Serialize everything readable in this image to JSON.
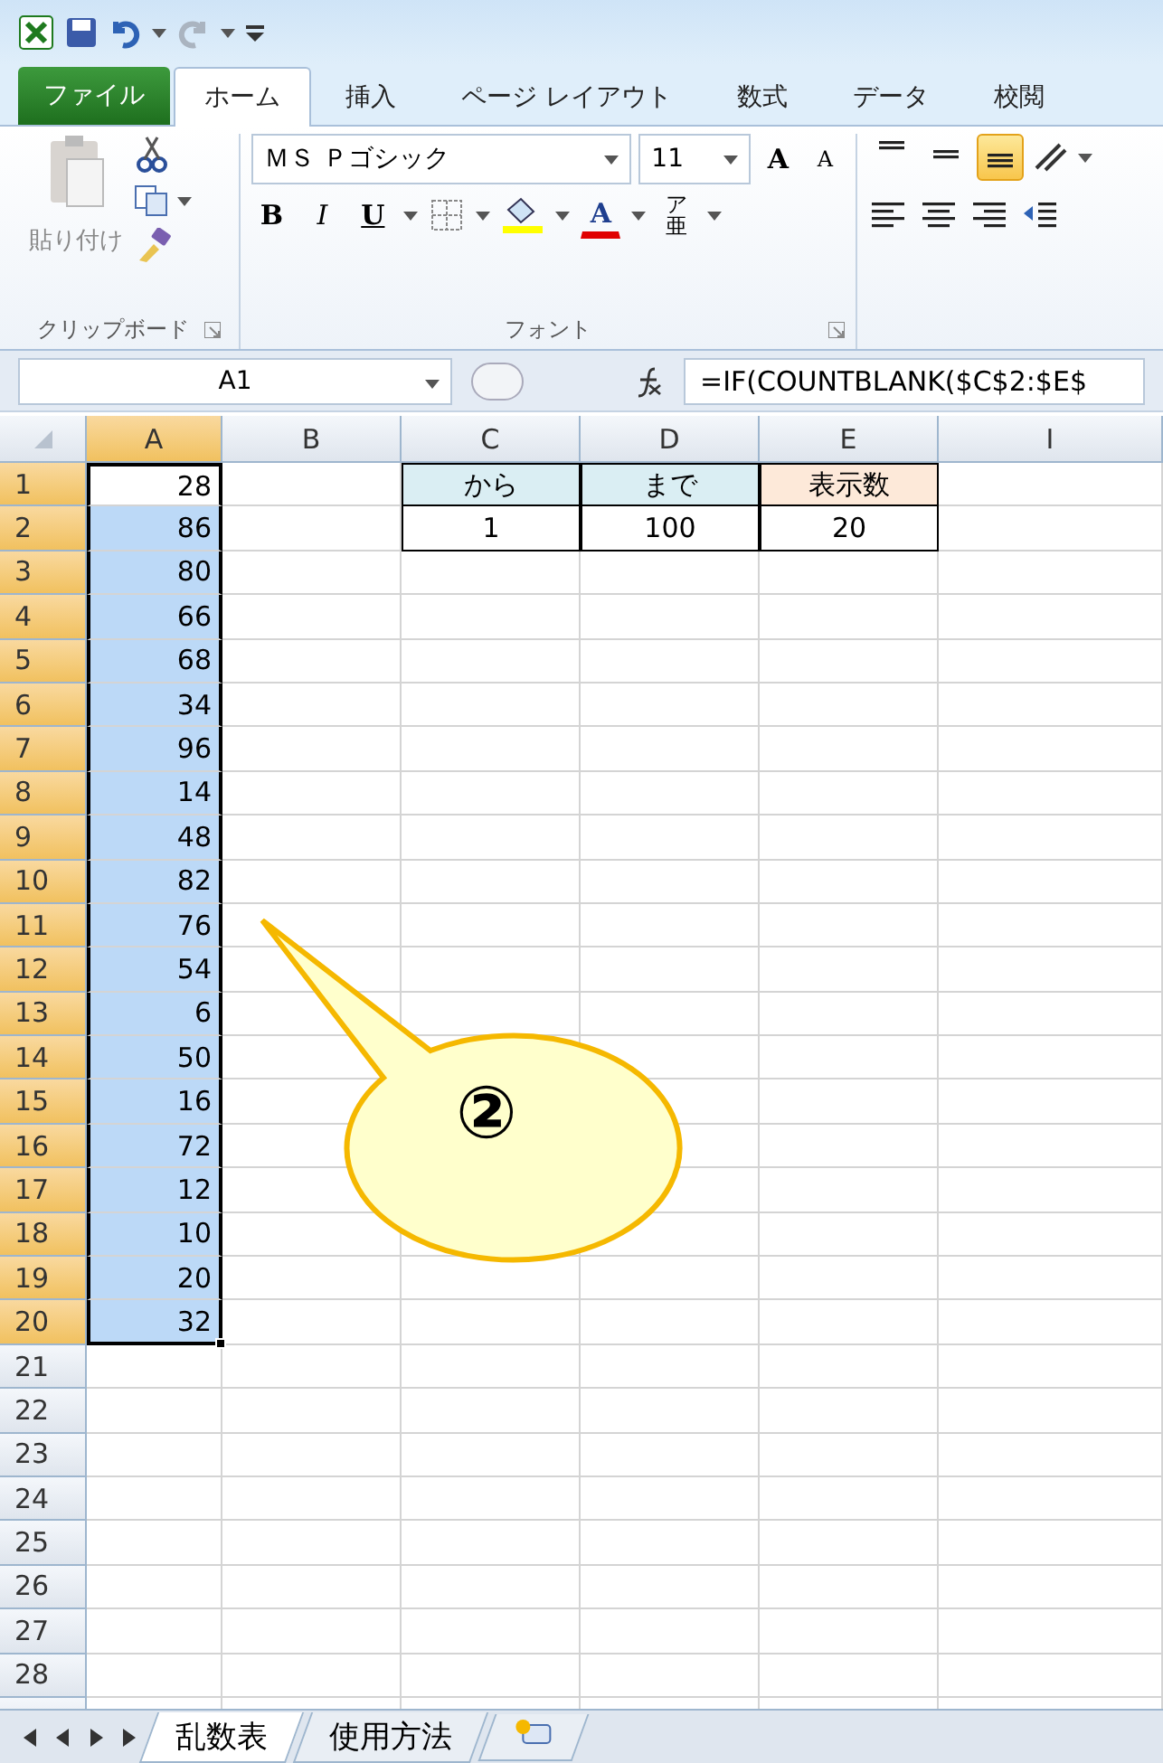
{
  "quick_access": {
    "redo_disabled": true
  },
  "ribbon_tabs": [
    {
      "label": "ファイル",
      "kind": "file",
      "selected": false
    },
    {
      "label": "ホーム",
      "kind": "tab",
      "selected": true
    },
    {
      "label": "挿入",
      "kind": "tab",
      "selected": false
    },
    {
      "label": "ページ レイアウト",
      "kind": "tab",
      "selected": false
    },
    {
      "label": "数式",
      "kind": "tab",
      "selected": false
    },
    {
      "label": "データ",
      "kind": "tab",
      "selected": false
    },
    {
      "label": "校閲",
      "kind": "tab",
      "selected": false
    }
  ],
  "clipboard": {
    "paste_label": "貼り付け",
    "group_label": "クリップボード"
  },
  "font": {
    "font_name": "ＭＳ Ｐゴシック",
    "font_size": "11",
    "grow": "A",
    "shrink": "A",
    "bold": "B",
    "italic": "I",
    "underline": "U",
    "font_color_letter": "A",
    "phonetic_ruby": "ア",
    "phonetic_base": "亜",
    "group_label": "フォント"
  },
  "alignment": {
    "vertical": [
      {
        "kind": "top",
        "selected": false
      },
      {
        "kind": "middle",
        "selected": false
      },
      {
        "kind": "bottom",
        "selected": true
      }
    ]
  },
  "formula_bar": {
    "name_box": "A1",
    "formula": "=IF(COUNTBLANK($C$2:$E$"
  },
  "columns": [
    {
      "label": "A",
      "selected": true
    },
    {
      "label": "B",
      "selected": false
    },
    {
      "label": "C",
      "selected": false
    },
    {
      "label": "D",
      "selected": false
    },
    {
      "label": "E",
      "selected": false
    },
    {
      "label": "I",
      "selected": false
    }
  ],
  "rows": [
    {
      "number": "1",
      "selected": true,
      "cells": [
        {
          "value": "28",
          "selected": true,
          "active": true
        },
        {},
        {
          "value": "から",
          "color": "#daeef3",
          "centered": true,
          "bordered": true
        },
        {
          "value": "まで",
          "color": "#daeef3",
          "centered": true,
          "bordered": true
        },
        {
          "value": "表示数",
          "color": "#fde9d9",
          "centered": true,
          "bordered": true
        },
        {}
      ]
    },
    {
      "number": "2",
      "selected": true,
      "cells": [
        {
          "value": "86",
          "selected": true
        },
        {},
        {
          "value": "1",
          "centered": true,
          "bordered": true
        },
        {
          "value": "100",
          "centered": true,
          "bordered": true
        },
        {
          "value": "20",
          "centered": true,
          "bordered": true
        },
        {}
      ]
    },
    {
      "number": "3",
      "selected": true,
      "cells": [
        {
          "value": "80",
          "selected": true
        }
      ]
    },
    {
      "number": "4",
      "selected": true,
      "cells": [
        {
          "value": "66",
          "selected": true
        }
      ]
    },
    {
      "number": "5",
      "selected": true,
      "cells": [
        {
          "value": "68",
          "selected": true
        }
      ]
    },
    {
      "number": "6",
      "selected": true,
      "cells": [
        {
          "value": "34",
          "selected": true
        }
      ]
    },
    {
      "number": "7",
      "selected": true,
      "cells": [
        {
          "value": "96",
          "selected": true
        }
      ]
    },
    {
      "number": "8",
      "selected": true,
      "cells": [
        {
          "value": "14",
          "selected": true
        }
      ]
    },
    {
      "number": "9",
      "selected": true,
      "cells": [
        {
          "value": "48",
          "selected": true
        }
      ]
    },
    {
      "number": "10",
      "selected": true,
      "cells": [
        {
          "value": "82",
          "selected": true
        }
      ]
    },
    {
      "number": "11",
      "selected": true,
      "cells": [
        {
          "value": "76",
          "selected": true
        }
      ]
    },
    {
      "number": "12",
      "selected": true,
      "cells": [
        {
          "value": "54",
          "selected": true
        }
      ]
    },
    {
      "number": "13",
      "selected": true,
      "cells": [
        {
          "value": "6",
          "selected": true
        }
      ]
    },
    {
      "number": "14",
      "selected": true,
      "cells": [
        {
          "value": "50",
          "selected": true
        }
      ]
    },
    {
      "number": "15",
      "selected": true,
      "cells": [
        {
          "value": "16",
          "selected": true
        }
      ]
    },
    {
      "number": "16",
      "selected": true,
      "cells": [
        {
          "value": "72",
          "selected": true
        }
      ]
    },
    {
      "number": "17",
      "selected": true,
      "cells": [
        {
          "value": "12",
          "selected": true
        }
      ]
    },
    {
      "number": "18",
      "selected": true,
      "cells": [
        {
          "value": "10",
          "selected": true
        }
      ]
    },
    {
      "number": "19",
      "selected": true,
      "cells": [
        {
          "value": "20",
          "selected": true
        }
      ]
    },
    {
      "number": "20",
      "selected": true,
      "cells": [
        {
          "value": "32",
          "selected": true
        }
      ]
    },
    {
      "number": "21",
      "selected": false
    },
    {
      "number": "22",
      "selected": false
    },
    {
      "number": "23",
      "selected": false
    },
    {
      "number": "24",
      "selected": false
    },
    {
      "number": "25",
      "selected": false
    },
    {
      "number": "26",
      "selected": false
    },
    {
      "number": "27",
      "selected": false
    },
    {
      "number": "28",
      "selected": false
    }
  ],
  "callout": {
    "text": "②"
  },
  "sheet_tabs": [
    {
      "label": "乱数表",
      "selected": true
    },
    {
      "label": "使用方法",
      "selected": false
    }
  ]
}
